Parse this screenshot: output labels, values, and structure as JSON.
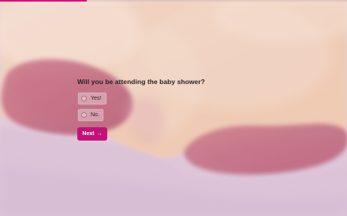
{
  "progress": {
    "fraction": 0.25,
    "color": "#e0007a"
  },
  "question": "Will you be attending the baby shower?",
  "choices": [
    {
      "label": "Yes!"
    },
    {
      "label": "No."
    }
  ],
  "next_button": {
    "label": "Next",
    "icon": "arrow-right-icon",
    "glyph": "→",
    "color": "#c2127a"
  },
  "colors": {
    "accent": "#c2127a",
    "background": "#efe7ea"
  }
}
